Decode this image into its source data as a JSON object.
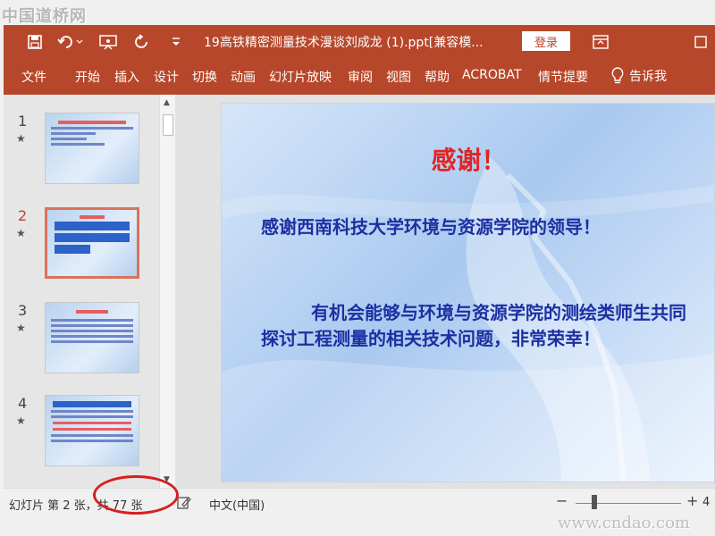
{
  "watermark": {
    "top": "中国道桥网",
    "bottom": "www.cndao.com"
  },
  "titlebar": {
    "icons": [
      "save-icon",
      "undo-icon",
      "present-icon",
      "redo-icon",
      "customize-icon"
    ],
    "document_title": "19高铁精密测量技术漫谈刘成龙 (1).ppt[兼容模...",
    "login_label": "登录",
    "window_icons": [
      "ribbon-display-icon",
      "maximize-icon"
    ],
    "accent_color": "#b7472a"
  },
  "ribbon": {
    "tabs": [
      "文件",
      "开始",
      "插入",
      "设计",
      "切换",
      "动画",
      "幻灯片放映",
      "审阅",
      "视图",
      "帮助",
      "ACROBAT",
      "情节提要"
    ],
    "tell_me": "告诉我"
  },
  "thumbnails": [
    {
      "number": "1",
      "selected": false
    },
    {
      "number": "2",
      "selected": true
    },
    {
      "number": "3",
      "selected": false
    },
    {
      "number": "4",
      "selected": false
    }
  ],
  "slide": {
    "title": "感谢！",
    "line1": "感谢西南科技大学环境与资源学院的领导！",
    "line2": "有机会能够与环境与资源学院的测绘类师生共同探讨工程测量的相关技术问题，非常荣幸！",
    "title_color": "#e02424",
    "text_color": "#1d2fa3"
  },
  "status": {
    "slide_info": "幻灯片 第 2 张，共 77 张",
    "language": "中文(中国)",
    "zoom_out": "−",
    "zoom_in": "+",
    "zoom_level": "4"
  }
}
